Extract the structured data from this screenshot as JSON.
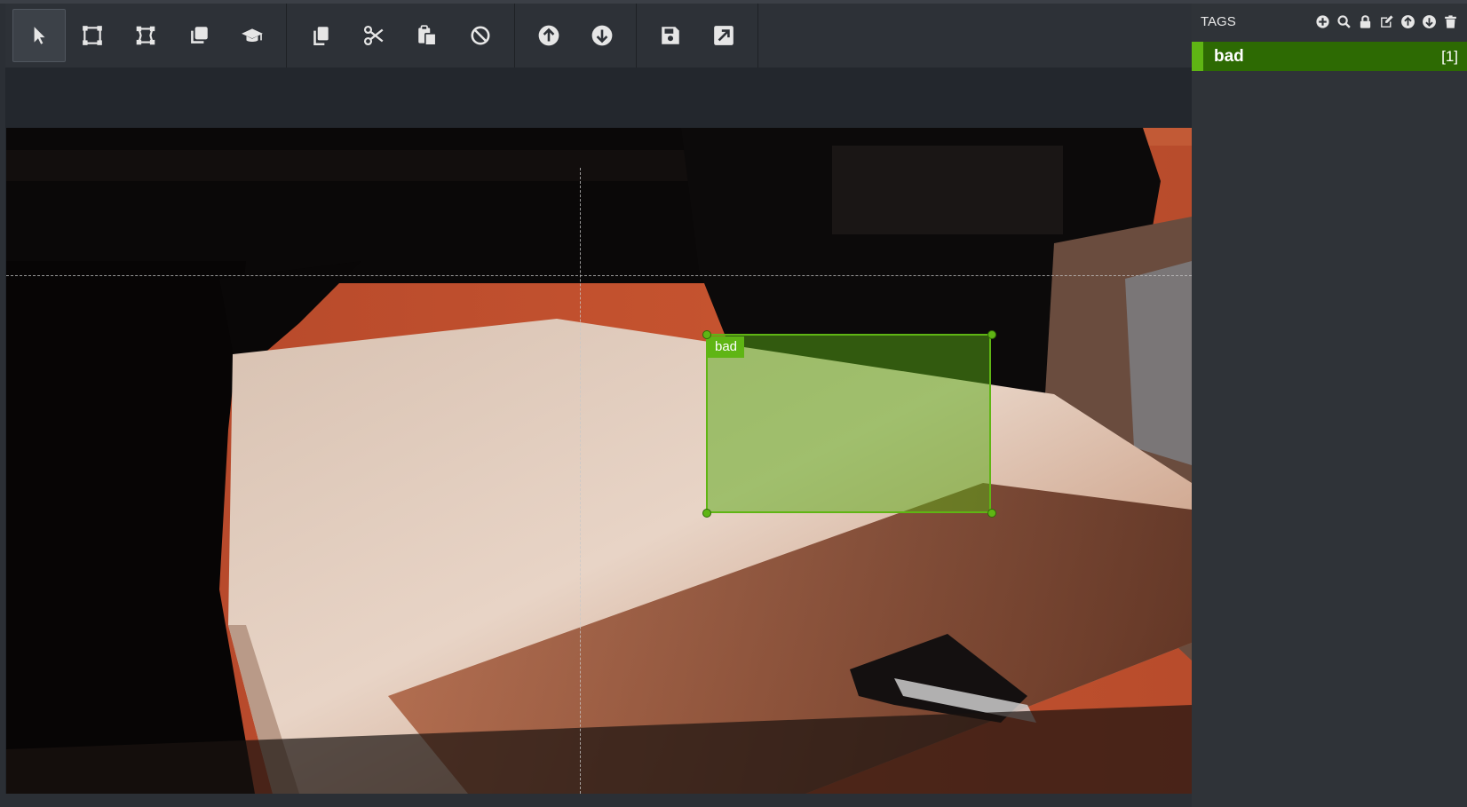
{
  "toolbar": {
    "groups": [
      [
        "pointer-icon",
        "rectangle-icon",
        "polygon-icon",
        "copy-rectangle-icon",
        "graduation-cap-icon"
      ],
      [
        "copy-icon",
        "scissors-icon",
        "paste-icon",
        "ban-icon"
      ],
      [
        "arrow-up-icon",
        "arrow-down-icon"
      ],
      [
        "save-icon",
        "export-icon"
      ]
    ],
    "active_tool": "pointer-icon"
  },
  "region": {
    "tag": "bad",
    "color": "#5fb514"
  },
  "sidebar": {
    "title": "TAGS",
    "header_icons": [
      "add-icon",
      "search-icon",
      "lock-icon",
      "edit-icon",
      "arrow-up-circle-icon",
      "arrow-down-circle-icon",
      "trash-icon"
    ],
    "tags": [
      {
        "name": "bad",
        "count": "[1]",
        "color": "#5fb514"
      }
    ]
  }
}
